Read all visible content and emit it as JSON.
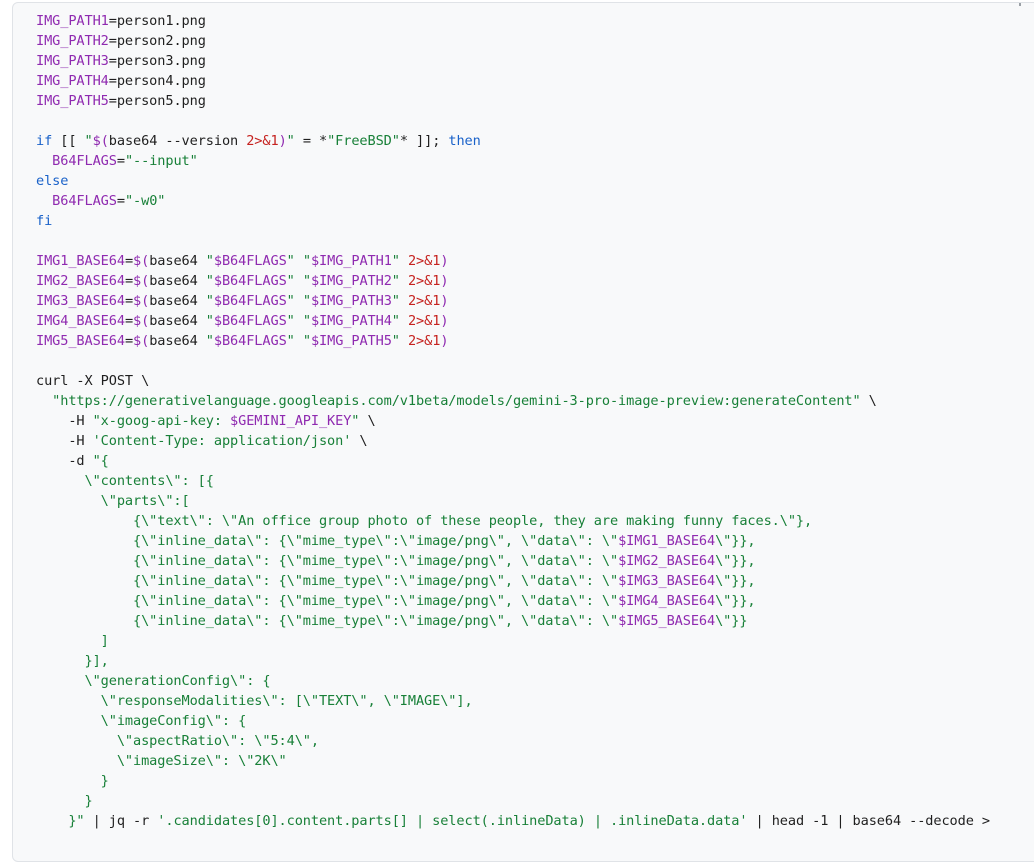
{
  "colors": {
    "default": "#1f1f1f",
    "variable": "#8f2ab0",
    "string": "#188038",
    "keyword": "#1a62c9",
    "number": "#c5221f",
    "background": "#f8f9fa"
  },
  "code": {
    "language": "bash",
    "lines": [
      [
        [
          "v",
          "IMG_PATH1"
        ],
        [
          "d",
          "=person1.png"
        ]
      ],
      [
        [
          "v",
          "IMG_PATH2"
        ],
        [
          "d",
          "=person2.png"
        ]
      ],
      [
        [
          "v",
          "IMG_PATH3"
        ],
        [
          "d",
          "=person3.png"
        ]
      ],
      [
        [
          "v",
          "IMG_PATH4"
        ],
        [
          "d",
          "=person4.png"
        ]
      ],
      [
        [
          "v",
          "IMG_PATH5"
        ],
        [
          "d",
          "=person5.png"
        ]
      ],
      [],
      [
        [
          "k",
          "if"
        ],
        [
          "d",
          " [[ "
        ],
        [
          "s",
          "\""
        ],
        [
          "v",
          "$("
        ],
        [
          "d",
          "base64 --version "
        ],
        [
          "n",
          "2>&1"
        ],
        [
          "v",
          ")"
        ],
        [
          "s",
          "\""
        ],
        [
          "d",
          " = *"
        ],
        [
          "s",
          "\"FreeBSD\""
        ],
        [
          "d",
          "* ]]; "
        ],
        [
          "k",
          "then"
        ]
      ],
      [
        [
          "d",
          "  "
        ],
        [
          "v",
          "B64FLAGS"
        ],
        [
          "d",
          "="
        ],
        [
          "s",
          "\"--input\""
        ]
      ],
      [
        [
          "k",
          "else"
        ]
      ],
      [
        [
          "d",
          "  "
        ],
        [
          "v",
          "B64FLAGS"
        ],
        [
          "d",
          "="
        ],
        [
          "s",
          "\"-w0\""
        ]
      ],
      [
        [
          "k",
          "fi"
        ]
      ],
      [],
      [
        [
          "v",
          "IMG1_BASE64"
        ],
        [
          "d",
          "="
        ],
        [
          "v",
          "$("
        ],
        [
          "d",
          "base64 "
        ],
        [
          "s",
          "\""
        ],
        [
          "v",
          "$B64FLAGS"
        ],
        [
          "s",
          "\""
        ],
        [
          "d",
          " "
        ],
        [
          "s",
          "\""
        ],
        [
          "v",
          "$IMG_PATH1"
        ],
        [
          "s",
          "\""
        ],
        [
          "d",
          " "
        ],
        [
          "n",
          "2>&1"
        ],
        [
          "v",
          ")"
        ]
      ],
      [
        [
          "v",
          "IMG2_BASE64"
        ],
        [
          "d",
          "="
        ],
        [
          "v",
          "$("
        ],
        [
          "d",
          "base64 "
        ],
        [
          "s",
          "\""
        ],
        [
          "v",
          "$B64FLAGS"
        ],
        [
          "s",
          "\""
        ],
        [
          "d",
          " "
        ],
        [
          "s",
          "\""
        ],
        [
          "v",
          "$IMG_PATH2"
        ],
        [
          "s",
          "\""
        ],
        [
          "d",
          " "
        ],
        [
          "n",
          "2>&1"
        ],
        [
          "v",
          ")"
        ]
      ],
      [
        [
          "v",
          "IMG3_BASE64"
        ],
        [
          "d",
          "="
        ],
        [
          "v",
          "$("
        ],
        [
          "d",
          "base64 "
        ],
        [
          "s",
          "\""
        ],
        [
          "v",
          "$B64FLAGS"
        ],
        [
          "s",
          "\""
        ],
        [
          "d",
          " "
        ],
        [
          "s",
          "\""
        ],
        [
          "v",
          "$IMG_PATH3"
        ],
        [
          "s",
          "\""
        ],
        [
          "d",
          " "
        ],
        [
          "n",
          "2>&1"
        ],
        [
          "v",
          ")"
        ]
      ],
      [
        [
          "v",
          "IMG4_BASE64"
        ],
        [
          "d",
          "="
        ],
        [
          "v",
          "$("
        ],
        [
          "d",
          "base64 "
        ],
        [
          "s",
          "\""
        ],
        [
          "v",
          "$B64FLAGS"
        ],
        [
          "s",
          "\""
        ],
        [
          "d",
          " "
        ],
        [
          "s",
          "\""
        ],
        [
          "v",
          "$IMG_PATH4"
        ],
        [
          "s",
          "\""
        ],
        [
          "d",
          " "
        ],
        [
          "n",
          "2>&1"
        ],
        [
          "v",
          ")"
        ]
      ],
      [
        [
          "v",
          "IMG5_BASE64"
        ],
        [
          "d",
          "="
        ],
        [
          "v",
          "$("
        ],
        [
          "d",
          "base64 "
        ],
        [
          "s",
          "\""
        ],
        [
          "v",
          "$B64FLAGS"
        ],
        [
          "s",
          "\""
        ],
        [
          "d",
          " "
        ],
        [
          "s",
          "\""
        ],
        [
          "v",
          "$IMG_PATH5"
        ],
        [
          "s",
          "\""
        ],
        [
          "d",
          " "
        ],
        [
          "n",
          "2>&1"
        ],
        [
          "v",
          ")"
        ]
      ],
      [],
      [
        [
          "d",
          "curl -X POST \\"
        ]
      ],
      [
        [
          "d",
          "  "
        ],
        [
          "s",
          "\"https://generativelanguage.googleapis.com/v1beta/models/gemini-3-pro-image-preview:generateContent\""
        ],
        [
          "d",
          " \\"
        ]
      ],
      [
        [
          "d",
          "    -H "
        ],
        [
          "s",
          "\"x-goog-api-key: "
        ],
        [
          "v",
          "$GEMINI_API_KEY"
        ],
        [
          "s",
          "\""
        ],
        [
          "d",
          " \\"
        ]
      ],
      [
        [
          "d",
          "    -H "
        ],
        [
          "s",
          "'Content-Type: application/json'"
        ],
        [
          "d",
          " \\"
        ]
      ],
      [
        [
          "d",
          "    -d "
        ],
        [
          "s",
          "\"{"
        ]
      ],
      [
        [
          "s",
          "      \\\"contents\\\": [{"
        ]
      ],
      [
        [
          "s",
          "        \\\"parts\\\":["
        ]
      ],
      [
        [
          "s",
          "            {\\\"text\\\": \\\"An office group photo of these people, they are making funny faces.\\\"},"
        ]
      ],
      [
        [
          "s",
          "            {\\\"inline_data\\\": {\\\"mime_type\\\":\\\"image/png\\\", \\\"data\\\": \\\""
        ],
        [
          "v",
          "$IMG1_BASE64"
        ],
        [
          "s",
          "\\\"}},"
        ]
      ],
      [
        [
          "s",
          "            {\\\"inline_data\\\": {\\\"mime_type\\\":\\\"image/png\\\", \\\"data\\\": \\\""
        ],
        [
          "v",
          "$IMG2_BASE64"
        ],
        [
          "s",
          "\\\"}},"
        ]
      ],
      [
        [
          "s",
          "            {\\\"inline_data\\\": {\\\"mime_type\\\":\\\"image/png\\\", \\\"data\\\": \\\""
        ],
        [
          "v",
          "$IMG3_BASE64"
        ],
        [
          "s",
          "\\\"}},"
        ]
      ],
      [
        [
          "s",
          "            {\\\"inline_data\\\": {\\\"mime_type\\\":\\\"image/png\\\", \\\"data\\\": \\\""
        ],
        [
          "v",
          "$IMG4_BASE64"
        ],
        [
          "s",
          "\\\"}},"
        ]
      ],
      [
        [
          "s",
          "            {\\\"inline_data\\\": {\\\"mime_type\\\":\\\"image/png\\\", \\\"data\\\": \\\""
        ],
        [
          "v",
          "$IMG5_BASE64"
        ],
        [
          "s",
          "\\\"}}"
        ]
      ],
      [
        [
          "s",
          "        ]"
        ]
      ],
      [
        [
          "s",
          "      }],"
        ]
      ],
      [
        [
          "s",
          "      \\\"generationConfig\\\": {"
        ]
      ],
      [
        [
          "s",
          "        \\\"responseModalities\\\": [\\\"TEXT\\\", \\\"IMAGE\\\"],"
        ]
      ],
      [
        [
          "s",
          "        \\\"imageConfig\\\": {"
        ]
      ],
      [
        [
          "s",
          "          \\\"aspectRatio\\\": \\\"5:4\\\","
        ]
      ],
      [
        [
          "s",
          "          \\\"imageSize\\\": \\\"2K\\\""
        ]
      ],
      [
        [
          "s",
          "        }"
        ]
      ],
      [
        [
          "s",
          "      }"
        ]
      ],
      [
        [
          "s",
          "    }\""
        ],
        [
          "d",
          " | jq -r "
        ],
        [
          "s",
          "'.candidates[0].content.parts[] | select(.inlineData) | .inlineData.data'"
        ],
        [
          "d",
          " | head -1 | base64 --decode >"
        ]
      ]
    ]
  }
}
